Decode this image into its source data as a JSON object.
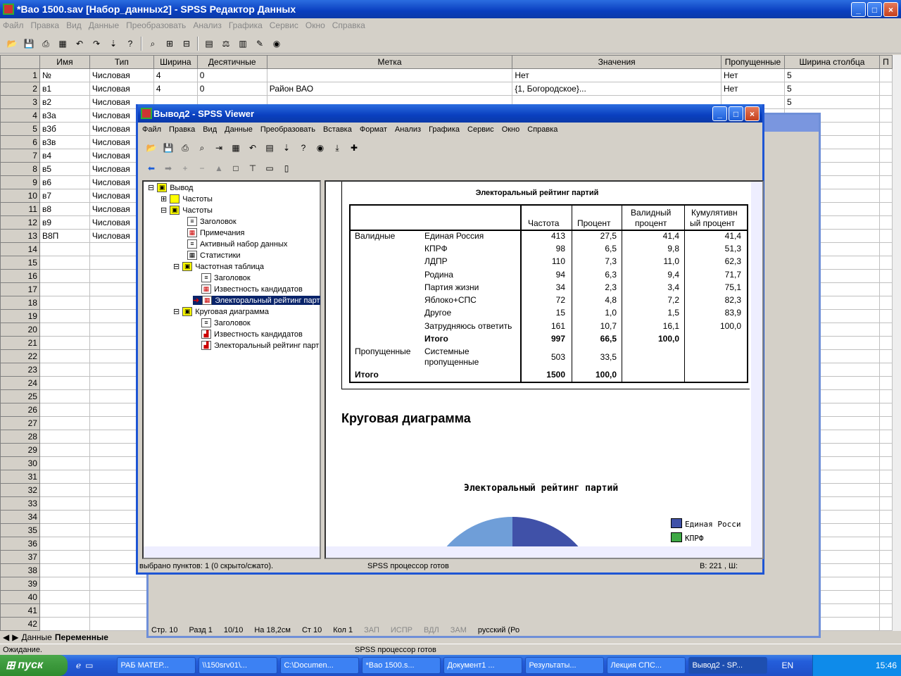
{
  "main": {
    "title": "*Вао 1500.sav [Набор_данных2] - SPSS Редактор Данных",
    "menu": [
      "Файл",
      "Правка",
      "Вид",
      "Данные",
      "Преобразовать",
      "Анализ",
      "Графика",
      "Сервис",
      "Окно",
      "Справка"
    ],
    "columns": [
      "Имя",
      "Тип",
      "Ширина",
      "Десятичные",
      "Метка",
      "Значения",
      "Пропущенные",
      "Ширина столбца"
    ],
    "rows": [
      [
        "№",
        "Числовая",
        "4",
        "0",
        "",
        "Нет",
        "Нет",
        "5"
      ],
      [
        "в1",
        "Числовая",
        "4",
        "0",
        "Район ВАО",
        "{1, Богородское}...",
        "Нет",
        "5"
      ],
      [
        "в2",
        "Числовая",
        "",
        "",
        "",
        "",
        "",
        "5"
      ],
      [
        "в3а",
        "Числовая",
        "",
        "",
        "",
        "",
        "",
        ""
      ],
      [
        "в3б",
        "Числовая",
        "",
        "",
        "",
        "",
        "",
        ""
      ],
      [
        "в3в",
        "Числовая",
        "",
        "",
        "",
        "",
        "",
        ""
      ],
      [
        "в4",
        "Числовая",
        "",
        "",
        "",
        "",
        "",
        ""
      ],
      [
        "в5",
        "Числовая",
        "",
        "",
        "",
        "",
        "",
        ""
      ],
      [
        "в6",
        "Числовая",
        "",
        "",
        "",
        "",
        "",
        ""
      ],
      [
        "в7",
        "Числовая",
        "",
        "",
        "",
        "",
        "",
        ""
      ],
      [
        "в8",
        "Числовая",
        "",
        "",
        "",
        "",
        "",
        ""
      ],
      [
        "в9",
        "Числовая",
        "",
        "",
        "",
        "",
        "",
        ""
      ],
      [
        "В8П",
        "Числовая",
        "",
        "",
        "",
        "",
        "",
        ""
      ]
    ],
    "row_numbers": [
      "1",
      "2",
      "3",
      "4",
      "5",
      "6",
      "7",
      "8",
      "9",
      "10",
      "11",
      "12",
      "13",
      "14",
      "15",
      "16",
      "17",
      "18",
      "19",
      "20",
      "21",
      "22",
      "23",
      "24",
      "25",
      "26",
      "27",
      "28",
      "29",
      "30",
      "31",
      "32",
      "33",
      "34",
      "35",
      "36",
      "37",
      "38",
      "39",
      "40",
      "41",
      "42"
    ],
    "tab_data": "Данные",
    "tab_vars": "Переменные",
    "status_left": "Ожидание.",
    "status_mid": "SPSS процессор готов"
  },
  "viewer": {
    "title": "Вывод2 - SPSS Viewer",
    "menu": [
      "Файл",
      "Правка",
      "Вид",
      "Данные",
      "Преобразовать",
      "Вставка",
      "Формат",
      "Анализ",
      "Графика",
      "Сервис",
      "Окно",
      "Справка"
    ],
    "tree": [
      "Вывод",
      "Частоты",
      "Частоты",
      "Заголовок",
      "Примечания",
      "Активный набор данных",
      "Статистики",
      "Частотная таблица",
      "Заголовок",
      "Известность  кандидатов",
      "Электоральный рейтинг парт",
      "Круговая диаграмма",
      "Заголовок",
      "Известность  кандидатов",
      "Электоральный рейтинг парт"
    ],
    "table_title": "Электоральный рейтинг партий",
    "headers": [
      "Частота",
      "Процент",
      "Валидный процент",
      "Кумулятивный процент"
    ],
    "header_lines": {
      "valid1": "Валидный",
      "valid2": "процент",
      "cum1": "Кумулятивн",
      "cum2": "ый процент"
    },
    "group_valid": "Валидные",
    "group_missing": "Пропущенные",
    "total_label": "Итого",
    "missing_label1": "Системные",
    "missing_label2": "пропущенные",
    "table_rows": [
      [
        "Единая Россия",
        "413",
        "27,5",
        "41,4",
        "41,4"
      ],
      [
        "КПРФ",
        "98",
        "6,5",
        "9,8",
        "51,3"
      ],
      [
        "ЛДПР",
        "110",
        "7,3",
        "11,0",
        "62,3"
      ],
      [
        "Родина",
        "94",
        "6,3",
        "9,4",
        "71,7"
      ],
      [
        "Партия жизни",
        "34",
        "2,3",
        "3,4",
        "75,1"
      ],
      [
        "Яблоко+СПС",
        "72",
        "4,8",
        "7,2",
        "82,3"
      ],
      [
        "Другое",
        "15",
        "1,0",
        "1,5",
        "83,9"
      ],
      [
        "Затрудняюсь ответить",
        "161",
        "10,7",
        "16,1",
        "100,0"
      ],
      [
        "Итого",
        "997",
        "66,5",
        "100,0",
        ""
      ]
    ],
    "missing_values": [
      "503",
      "33,5"
    ],
    "total_values": [
      "1500",
      "100,0"
    ],
    "pie_heading": "Круговая диаграмма",
    "pie_title": "Электоральный рейтинг партий",
    "legend": [
      "Единая Росси",
      "КПРФ"
    ],
    "status_left": "выбрано пунктов: 1  (0 скрыто/сжато).",
    "status_mid": "SPSS процессор готов",
    "status_right": "В: 221 , Ш:"
  },
  "word": {
    "status": [
      "Стр. 10",
      "Разд  1",
      "10/10",
      "На 18,2см",
      "Ст  10",
      "Кол  1",
      "ЗАП",
      "ИСПР",
      "ВДЛ",
      "ЗАМ",
      "русский (Ро"
    ]
  },
  "taskbar": {
    "start": "пуск",
    "items": [
      "РАБ МАТЕР...",
      "\\\\150srv01\\...",
      "C:\\Documen...",
      "*Вао 1500.s...",
      "Документ1 ...",
      "Результаты...",
      "Лекция СПС...",
      "Вывод2 - SP..."
    ],
    "lang": "EN",
    "clock": "15:46"
  }
}
